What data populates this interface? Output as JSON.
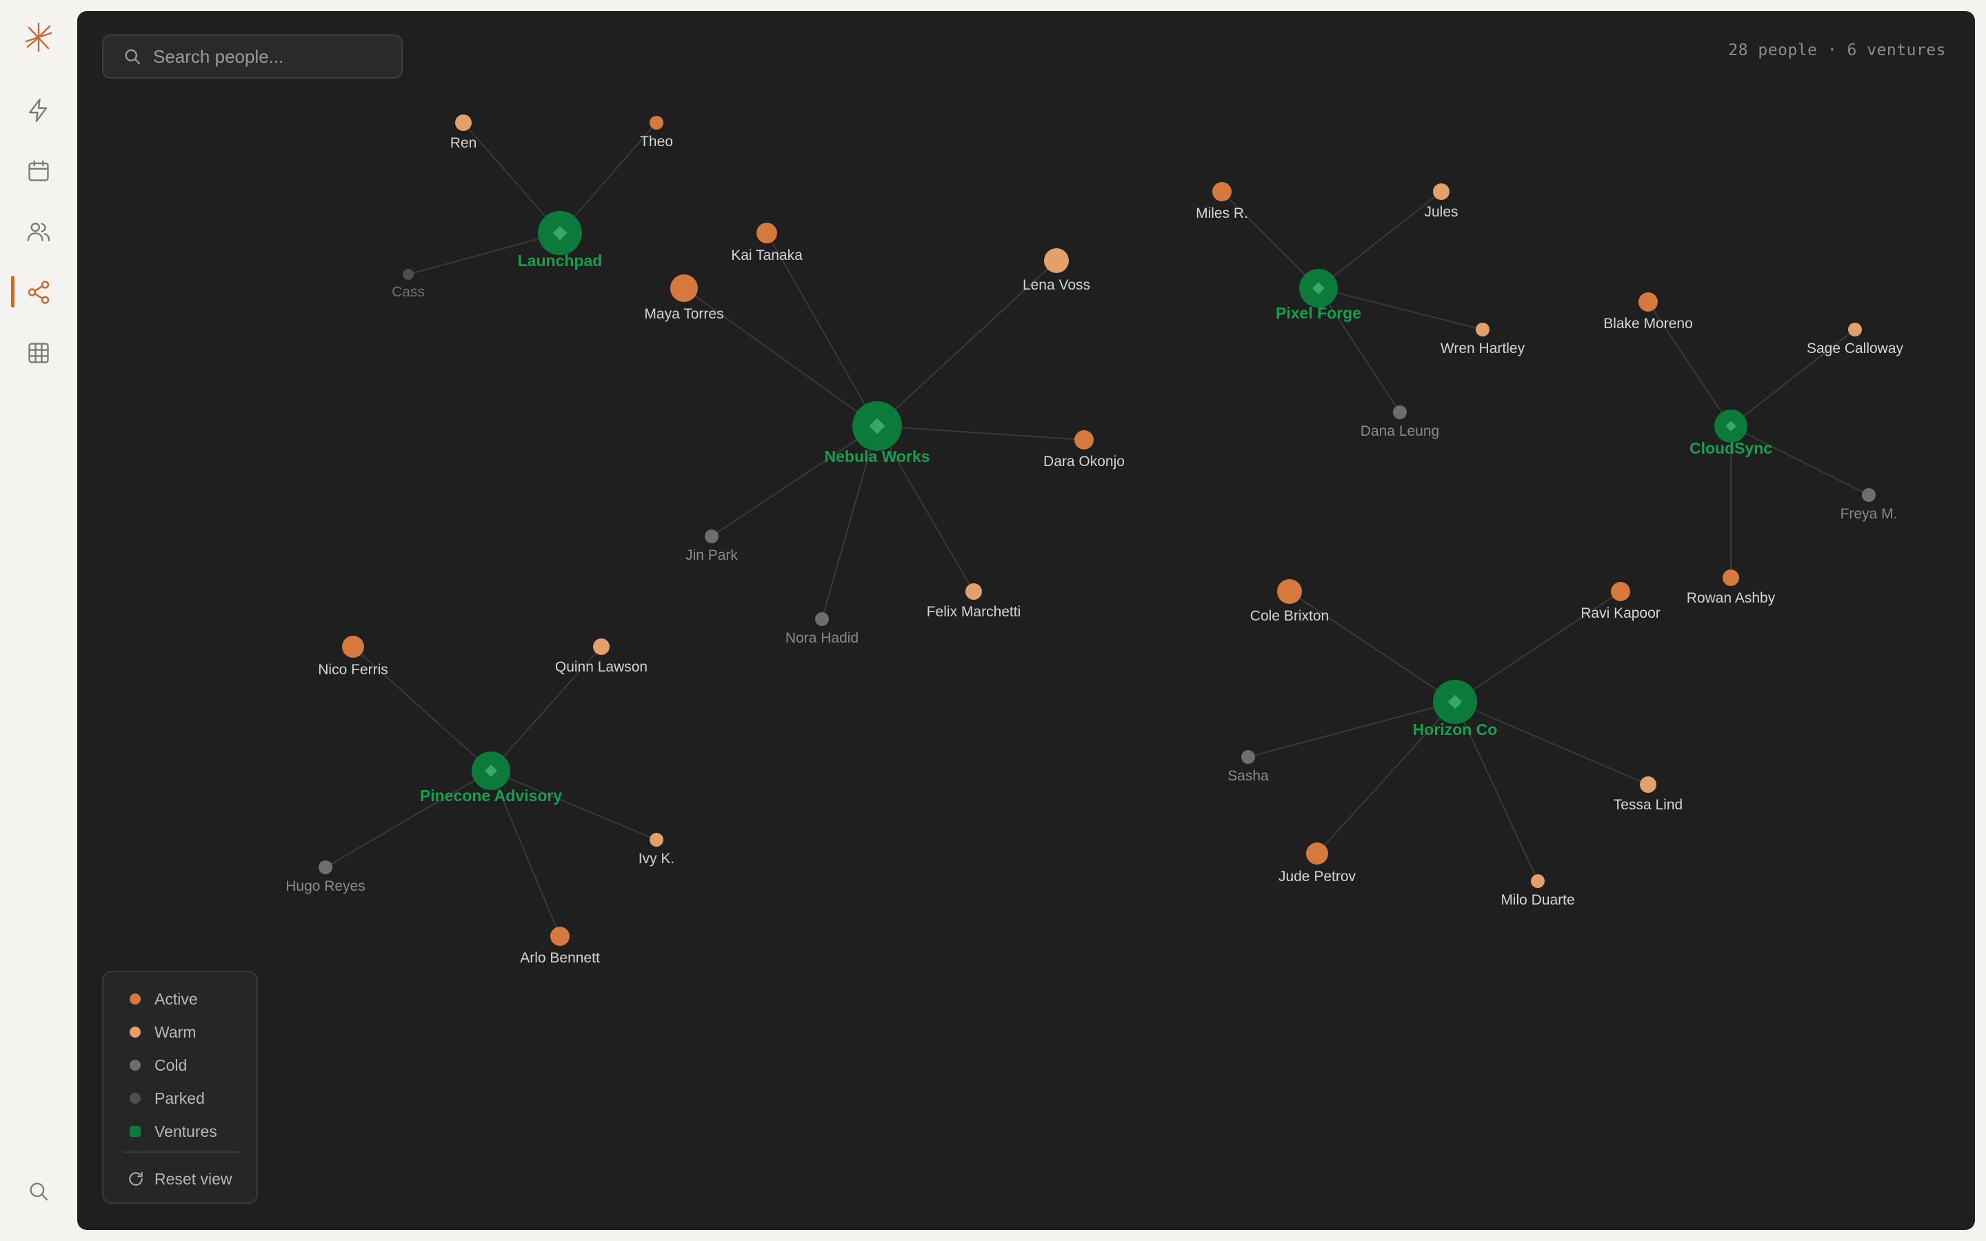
{
  "search": {
    "placeholder": "Search people..."
  },
  "stats": "28 people · 6 ventures",
  "colors": {
    "accent": "#c96a34",
    "active": "#d6793e",
    "warm": "#e3a06b",
    "cold": "#6e6e6e",
    "parked": "#4e4e4e",
    "venture": "#0c7a3a",
    "venture_label": "#14a04e"
  },
  "sidebar": {
    "items": [
      {
        "name": "activity",
        "icon": "bolt-icon"
      },
      {
        "name": "calendar",
        "icon": "calendar-icon"
      },
      {
        "name": "people",
        "icon": "users-icon"
      },
      {
        "name": "network",
        "icon": "share-icon",
        "active": true
      },
      {
        "name": "table",
        "icon": "grid-icon"
      }
    ],
    "bottom_icon": "search-icon"
  },
  "legend": {
    "items": [
      {
        "label": "Active",
        "status": "active"
      },
      {
        "label": "Warm",
        "status": "warm"
      },
      {
        "label": "Cold",
        "status": "cold"
      },
      {
        "label": "Parked",
        "status": "parked"
      },
      {
        "label": "Ventures",
        "status": "venture"
      }
    ],
    "reset_label": "Reset view"
  },
  "graph": {
    "ventures": [
      {
        "id": "launchpad",
        "label": "Launchpad"
      },
      {
        "id": "nebula",
        "label": "Nebula Works"
      },
      {
        "id": "pixel",
        "label": "Pixel Forge"
      },
      {
        "id": "cloudsync",
        "label": "CloudSync"
      },
      {
        "id": "horizon",
        "label": "Horizon Co"
      },
      {
        "id": "pinecone",
        "label": "Pinecone Advisory"
      }
    ],
    "people": [
      {
        "label": "Ren",
        "status": "warm",
        "venture": "launchpad"
      },
      {
        "label": "Theo",
        "status": "active",
        "venture": "launchpad"
      },
      {
        "label": "Cass",
        "status": "parked",
        "venture": "launchpad"
      },
      {
        "label": "Kai Tanaka",
        "status": "active",
        "venture": "nebula"
      },
      {
        "label": "Maya Torres",
        "status": "active",
        "venture": "nebula"
      },
      {
        "label": "Lena Voss",
        "status": "warm",
        "venture": "nebula"
      },
      {
        "label": "Dara Okonjo",
        "status": "active",
        "venture": "nebula"
      },
      {
        "label": "Jin Park",
        "status": "cold",
        "venture": "nebula"
      },
      {
        "label": "Nora Hadid",
        "status": "cold",
        "venture": "nebula"
      },
      {
        "label": "Felix Marchetti",
        "status": "warm",
        "venture": "nebula"
      },
      {
        "label": "Miles R.",
        "status": "active",
        "venture": "pixel"
      },
      {
        "label": "Jules",
        "status": "warm",
        "venture": "pixel"
      },
      {
        "label": "Wren Hartley",
        "status": "warm",
        "venture": "pixel"
      },
      {
        "label": "Dana Leung",
        "status": "cold",
        "venture": "pixel"
      },
      {
        "label": "Blake Moreno",
        "status": "active",
        "venture": "cloudsync"
      },
      {
        "label": "Sage Calloway",
        "status": "warm",
        "venture": "cloudsync"
      },
      {
        "label": "Freya M.",
        "status": "cold",
        "venture": "cloudsync"
      },
      {
        "label": "Rowan Ashby",
        "status": "active",
        "venture": "cloudsync"
      },
      {
        "label": "Cole Brixton",
        "status": "active",
        "venture": "horizon"
      },
      {
        "label": "Ravi Kapoor",
        "status": "active",
        "venture": "horizon"
      },
      {
        "label": "Sasha",
        "status": "cold",
        "venture": "horizon"
      },
      {
        "label": "Tessa Lind",
        "status": "warm",
        "venture": "horizon"
      },
      {
        "label": "Jude Petrov",
        "status": "active",
        "venture": "horizon"
      },
      {
        "label": "Milo Duarte",
        "status": "warm",
        "venture": "horizon"
      },
      {
        "label": "Nico Ferris",
        "status": "active",
        "venture": "pinecone"
      },
      {
        "label": "Quinn Lawson",
        "status": "warm",
        "venture": "pinecone"
      },
      {
        "label": "Hugo Reyes",
        "status": "cold",
        "venture": "pinecone"
      },
      {
        "label": "Ivy K.",
        "status": "warm",
        "venture": "pinecone"
      },
      {
        "label": "Arlo Bennett",
        "status": "active",
        "venture": "pinecone"
      }
    ]
  }
}
